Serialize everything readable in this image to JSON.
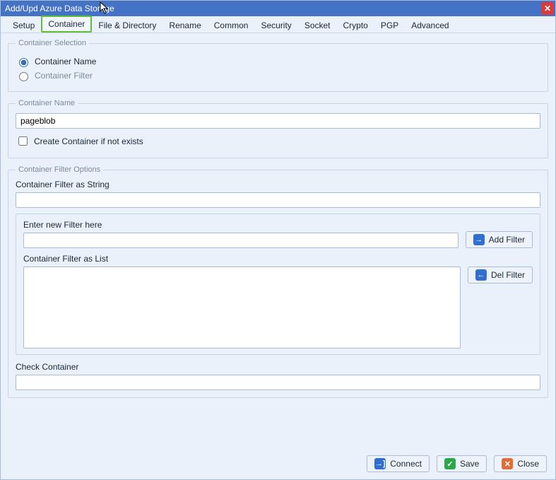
{
  "window": {
    "title": "Add/Upd Azure Data Storage"
  },
  "tabs": {
    "setup": "Setup",
    "container": "Container",
    "fileDirectory": "File & Directory",
    "rename": "Rename",
    "common": "Common",
    "security": "Security",
    "socket": "Socket",
    "crypto": "Crypto",
    "pgp": "PGP",
    "advanced": "Advanced"
  },
  "containerSelection": {
    "legend": "Container Selection",
    "optName": "Container Name",
    "optFilter": "Container Filter"
  },
  "containerName": {
    "legend": "Container Name",
    "value": "pageblob",
    "createIfNotExists": "Create Container if not exists"
  },
  "filterOptions": {
    "legend": "Container Filter Options",
    "filterString": "Container Filter as String",
    "enterNew": "Enter new Filter here",
    "addFilter": "Add Filter",
    "filterList": "Container Filter as List",
    "delFilter": "Del Filter",
    "checkContainer": "Check Container"
  },
  "buttons": {
    "connect": "Connect",
    "save": "Save",
    "close": "Close"
  }
}
